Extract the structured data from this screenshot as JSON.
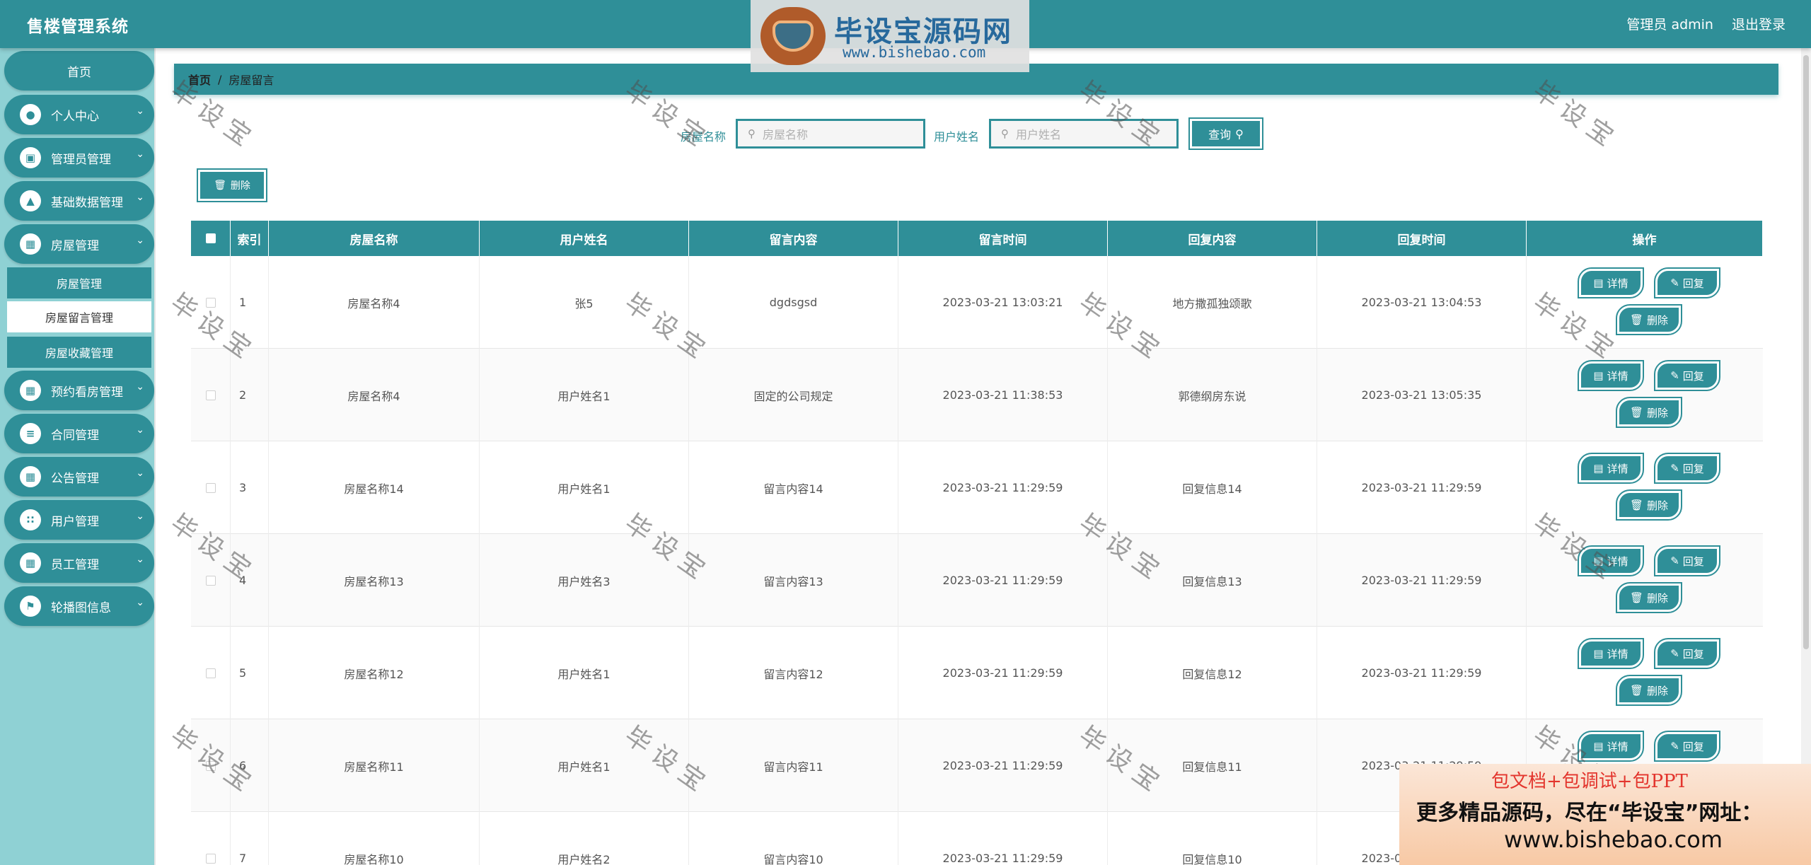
{
  "header": {
    "app_title": "售楼管理系统",
    "user_label": "管理员 admin",
    "logout_label": "退出登录"
  },
  "logo": {
    "badge_text": "毕设宝",
    "main_text": "毕设宝源码网",
    "sub_text": "www.bishebao.com"
  },
  "sidebar": {
    "home": "首页",
    "items": [
      {
        "label": "个人中心",
        "icon": "user-icon"
      },
      {
        "label": "管理员管理",
        "icon": "clipboard-icon"
      },
      {
        "label": "基础数据管理",
        "icon": "thumb-icon"
      },
      {
        "label": "房屋管理",
        "icon": "grid-icon"
      },
      {
        "label": "预约看房管理",
        "icon": "grid-icon"
      },
      {
        "label": "合同管理",
        "icon": "sliders-icon"
      },
      {
        "label": "公告管理",
        "icon": "grid-icon"
      },
      {
        "label": "用户管理",
        "icon": "grid-dots-icon"
      },
      {
        "label": "员工管理",
        "icon": "grid-icon"
      },
      {
        "label": "轮播图信息",
        "icon": "flag-icon"
      }
    ],
    "sub_items": [
      "房屋管理",
      "房屋留言管理",
      "房屋收藏管理"
    ]
  },
  "breadcrumb": {
    "home": "首页",
    "separator": "/",
    "current": "房屋留言"
  },
  "search": {
    "house_label": "房屋名称",
    "house_placeholder": "房屋名称",
    "user_label": "用户姓名",
    "user_placeholder": "用户姓名",
    "query_button": "查询"
  },
  "toolbar": {
    "delete_label": "删除"
  },
  "table": {
    "headers": [
      "索引",
      "房屋名称",
      "用户姓名",
      "留言内容",
      "留言时间",
      "回复内容",
      "回复时间",
      "操作"
    ],
    "actions": {
      "detail": "详情",
      "reply": "回复",
      "delete": "删除"
    },
    "rows": [
      {
        "index": "1",
        "house": "房屋名称4",
        "user": "张5",
        "message": "dgdsgsd",
        "msg_time": "2023-03-21 13:03:21",
        "reply": "地方撒孤独颂歌",
        "reply_time": "2023-03-21 13:04:53"
      },
      {
        "index": "2",
        "house": "房屋名称4",
        "user": "用户姓名1",
        "message": "固定的公司规定",
        "msg_time": "2023-03-21 11:38:53",
        "reply": "郭德纲房东说",
        "reply_time": "2023-03-21 13:05:35"
      },
      {
        "index": "3",
        "house": "房屋名称14",
        "user": "用户姓名1",
        "message": "留言内容14",
        "msg_time": "2023-03-21 11:29:59",
        "reply": "回复信息14",
        "reply_time": "2023-03-21 11:29:59"
      },
      {
        "index": "4",
        "house": "房屋名称13",
        "user": "用户姓名3",
        "message": "留言内容13",
        "msg_time": "2023-03-21 11:29:59",
        "reply": "回复信息13",
        "reply_time": "2023-03-21 11:29:59"
      },
      {
        "index": "5",
        "house": "房屋名称12",
        "user": "用户姓名1",
        "message": "留言内容12",
        "msg_time": "2023-03-21 11:29:59",
        "reply": "回复信息12",
        "reply_time": "2023-03-21 11:29:59"
      },
      {
        "index": "6",
        "house": "房屋名称11",
        "user": "用户姓名1",
        "message": "留言内容11",
        "msg_time": "2023-03-21 11:29:59",
        "reply": "回复信息11",
        "reply_time": "2023-03-21 11:29:59"
      },
      {
        "index": "7",
        "house": "房屋名称10",
        "user": "用户姓名2",
        "message": "留言内容10",
        "msg_time": "2023-03-21 11:29:59",
        "reply": "回复信息10",
        "reply_time": "2023-03-21 11:29:59"
      }
    ]
  },
  "watermark_text": "毕设宝",
  "ad": {
    "line1": "包文档+包调试+包PPT",
    "line2": "更多精品源码，尽在“毕设宝”网址：",
    "line3": "www.bishebao.com"
  },
  "colors": {
    "primary": "#2f8f98",
    "sidebar_bg": "#8fd1d4"
  }
}
